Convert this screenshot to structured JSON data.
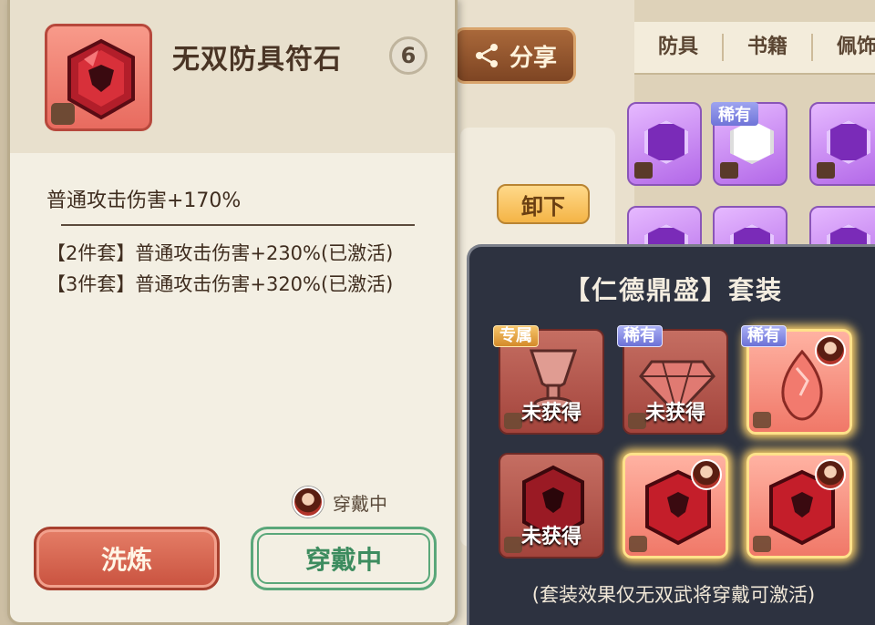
{
  "item": {
    "name": "无双防具符石",
    "level": "6",
    "main_stat": "普通攻击伤害+170%",
    "set_bonuses": [
      "【2件套】普通攻击伤害+230%(已激活)",
      "【3件套】普通攻击伤害+320%(已激活)"
    ],
    "wearing_status": "穿戴中"
  },
  "actions": {
    "refine_label": "洗炼",
    "wearing_label": "穿戴中",
    "share_label": "分享",
    "unload_label": "卸下"
  },
  "tabs": [
    "防具",
    "书籍",
    "佩饰"
  ],
  "background_tag": "稀有",
  "set_popup": {
    "title": "【仁德鼎盛】套装",
    "note": "(套装效果仅无双武将穿戴可激活)",
    "cards": [
      {
        "tag": "专属",
        "caption": "未获得"
      },
      {
        "tag": "稀有",
        "caption": "未获得"
      },
      {
        "tag": "稀有",
        "caption": ""
      },
      {
        "tag": "",
        "caption": "未获得"
      },
      {
        "tag": "",
        "caption": ""
      },
      {
        "tag": "",
        "caption": ""
      }
    ]
  },
  "colors": {
    "accent_red": "#c9523f",
    "accent_green": "#3d8c5f",
    "rare_purple": "#6c71d6",
    "exclusive_gold": "#d48a2a"
  },
  "icons": [
    "share-icon",
    "gem-icon",
    "lock-level-icon",
    "avatar-icon"
  ]
}
